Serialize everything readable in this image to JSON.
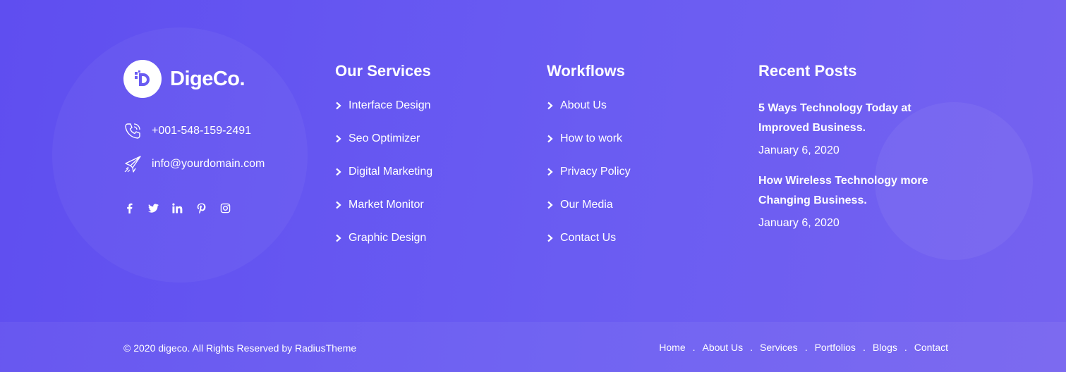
{
  "brand": {
    "name": "DigeCo."
  },
  "contact": {
    "phone": "+001-548-159-2491",
    "email": "info@yourdomain.com"
  },
  "social": [
    "facebook-icon",
    "twitter-icon",
    "linkedin-icon",
    "pinterest-icon",
    "instagram-icon"
  ],
  "services": {
    "title": "Our Services",
    "items": [
      "Interface Design",
      "Seo Optimizer",
      "Digital Marketing",
      "Market Monitor",
      "Graphic Design"
    ]
  },
  "workflows": {
    "title": "Workflows",
    "items": [
      "About Us",
      "How to work",
      "Privacy Policy",
      "Our Media",
      "Contact Us"
    ]
  },
  "recent_posts": {
    "title": "Recent Posts",
    "posts": [
      {
        "title_line1": "5 Ways Technology Today at",
        "title_line2": "Improved Business.",
        "date": "January 6, 2020"
      },
      {
        "title_line1": "How Wireless Technology more",
        "title_line2": "Changing Business.",
        "date": "January 6, 2020"
      }
    ]
  },
  "footer_bottom": {
    "copyright": "© 2020 digeco. All Rights Reserved by RadiusTheme",
    "nav": [
      "Home",
      "About Us",
      "Services",
      "Portfolios",
      "Blogs",
      "Contact"
    ],
    "separator": "."
  },
  "colors": {
    "background_start": "#5f4ef0",
    "background_end": "#7562f0",
    "text": "#ffffff"
  }
}
